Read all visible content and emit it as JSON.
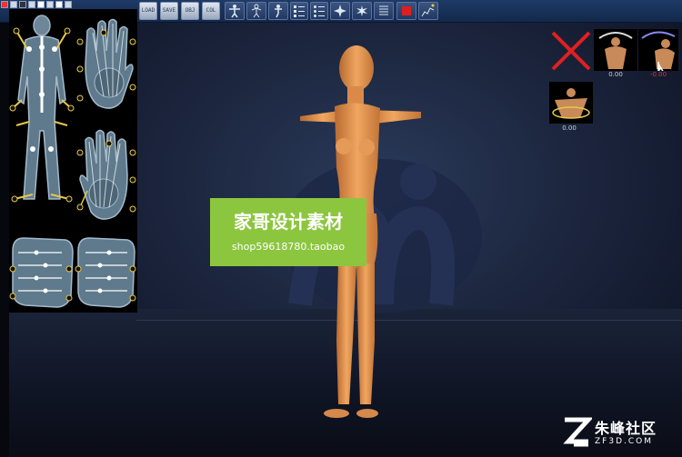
{
  "toolbar": {
    "load_label": "LOAD",
    "save_label": "SAVE",
    "obj_label": "OBJ",
    "col_label": "COL"
  },
  "gizmo": {
    "slot1_value": "0.00",
    "slot2_value": "-0.00",
    "slot3_value": "0.00"
  },
  "watermark": {
    "title": "家哥设计素材",
    "subtitle": "shop59618780.taobao"
  },
  "brand": {
    "name": "朱峰社区",
    "domain": "ZF3D.COM"
  },
  "colors": {
    "banner_green": "#8cc63f",
    "bone_yellow": "#e6c84a",
    "remove_red": "#e02020",
    "record_red": "#dd1f1f"
  },
  "icons": {
    "remove": "red-x-icon",
    "record": "record-square-icon"
  }
}
